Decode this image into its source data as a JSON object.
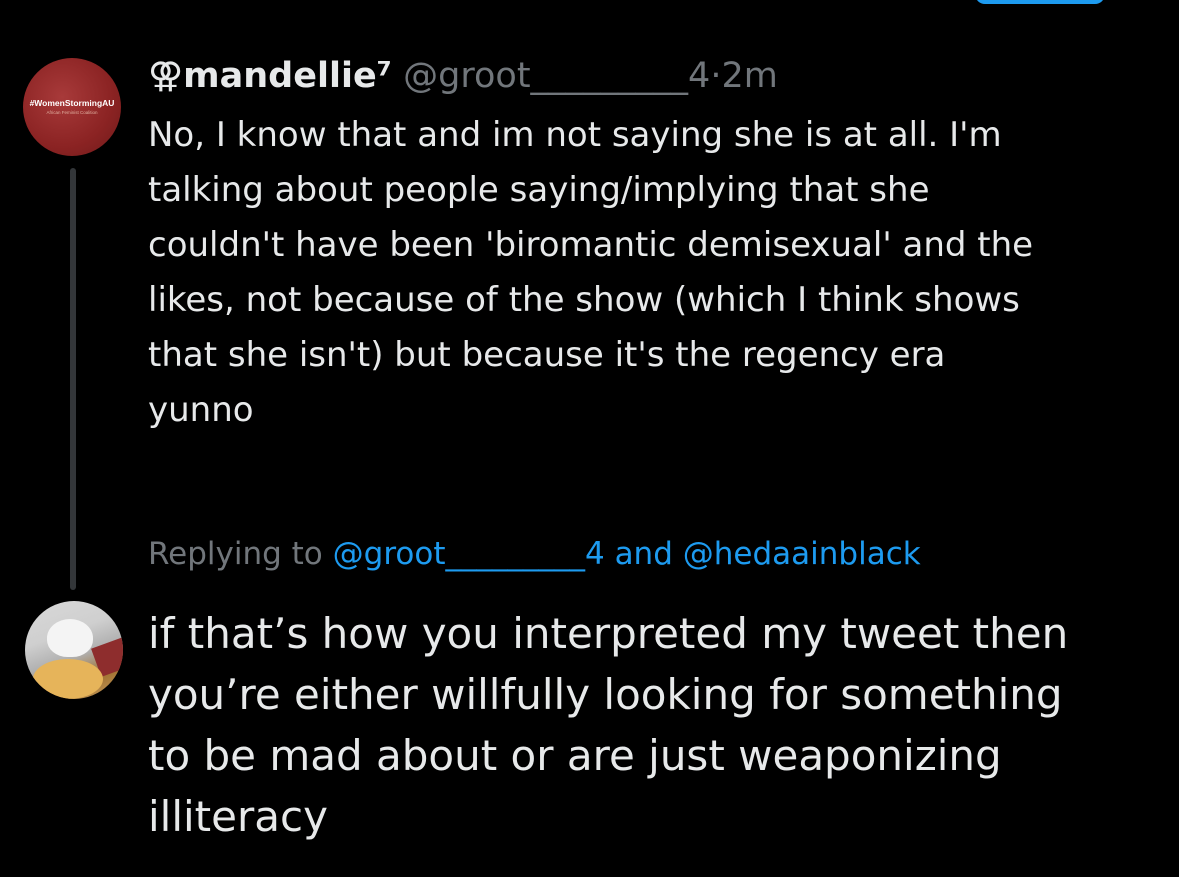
{
  "colors": {
    "background": "#000000",
    "text_primary": "#e7e9ea",
    "text_secondary": "#71767b",
    "link": "#1d9bf0",
    "thread_line": "#333639"
  },
  "tweet1": {
    "avatar_text": "#WomenStormingAU",
    "avatar_subtext": "African Feminist Coalition",
    "display_name": "⚢mandellie⁷",
    "handle": "@groot_________4",
    "separator": "·",
    "time": "2m",
    "body_lines": [
      "No, I know that and im not saying she is at all. I'm",
      "talking about people saying/implying that she",
      "couldn't have been 'biromantic demisexual' and the",
      "likes, not because of the show (which I think shows",
      "that she isn't) but because it's the regency era",
      "yunno"
    ]
  },
  "tweet2": {
    "replying_prefix": "Replying to",
    "replying_user1": "@groot_________4",
    "replying_and": "and",
    "replying_user2": "@hedaainblack",
    "body_lines": [
      "if that’s how you interpreted my tweet then",
      "you’re either willfully looking for something",
      "to be mad about or are just weaponizing",
      "illiteracy"
    ]
  }
}
